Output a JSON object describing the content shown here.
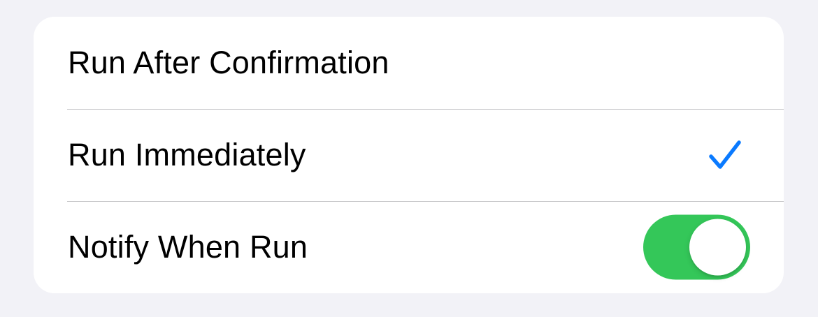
{
  "options": {
    "run_after_confirmation": {
      "label": "Run After Confirmation",
      "selected": false
    },
    "run_immediately": {
      "label": "Run Immediately",
      "selected": true
    },
    "notify_when_run": {
      "label": "Notify When Run",
      "on": true
    }
  },
  "colors": {
    "accent": "#0a7aff",
    "toggle_on": "#34c759",
    "background": "#f2f2f7",
    "separator": "#c6c6c8"
  },
  "icons": {
    "selected": "checkmark-icon"
  }
}
